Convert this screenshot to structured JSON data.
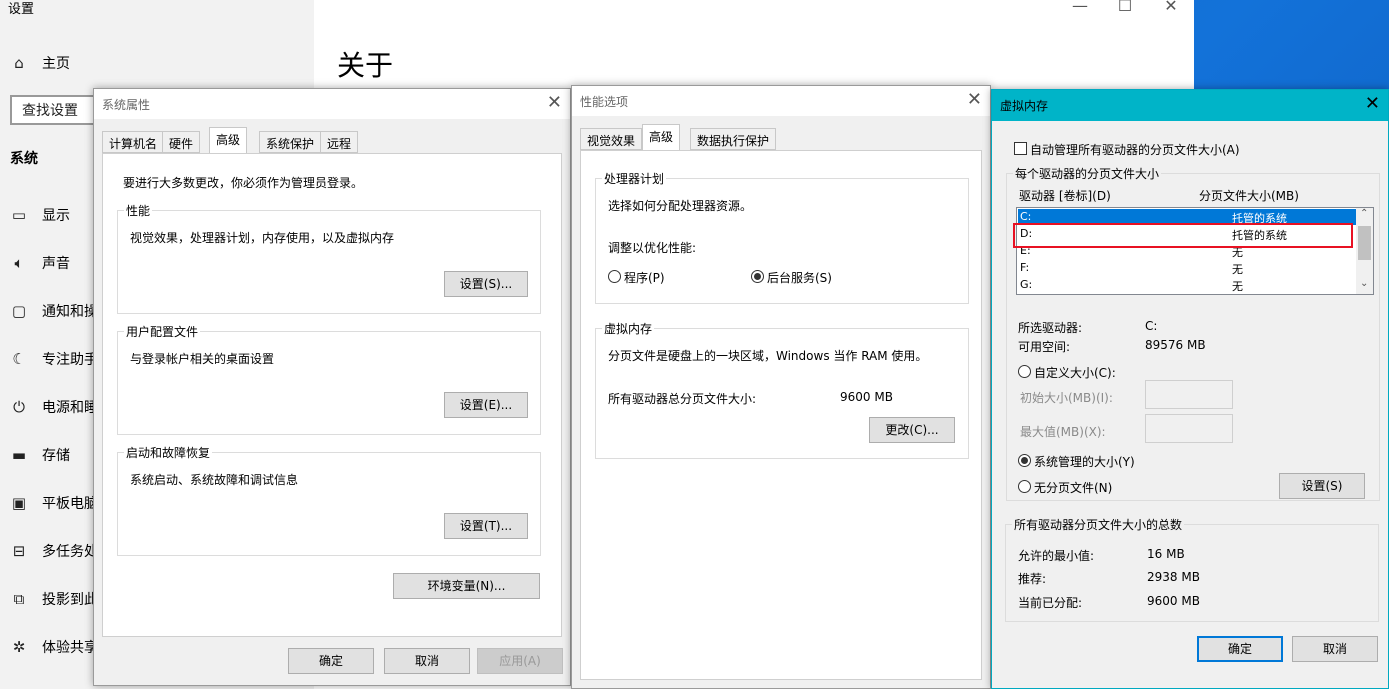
{
  "settings": {
    "title": "设置",
    "home": "主页",
    "search_placeholder": "查找设置",
    "section": "系统",
    "page_title": "关于",
    "nav": [
      {
        "label": "显示",
        "icon": "monitor-icon"
      },
      {
        "label": "声音",
        "icon": "speaker-icon"
      },
      {
        "label": "通知和操",
        "icon": "notification-icon"
      },
      {
        "label": "专注助手",
        "icon": "moon-icon"
      },
      {
        "label": "电源和睡",
        "icon": "power-icon"
      },
      {
        "label": "存储",
        "icon": "storage-icon"
      },
      {
        "label": "平板电脑",
        "icon": "tablet-icon"
      },
      {
        "label": "多任务处",
        "icon": "multitask-icon"
      },
      {
        "label": "投影到此",
        "icon": "project-icon"
      },
      {
        "label": "体验共享",
        "icon": "share-icon"
      }
    ],
    "controls": {
      "minimize": "—",
      "maximize": "☐",
      "close": "✕"
    }
  },
  "sysprop": {
    "title": "系统属性",
    "tabs": [
      "计算机名",
      "硬件",
      "高级",
      "系统保护",
      "远程"
    ],
    "active_tab": 2,
    "admin_note": "要进行大多数更改，你必须作为管理员登录。",
    "perf_label": "性能",
    "perf_desc": "视觉效果，处理器计划，内存使用，以及虚拟内存",
    "perf_btn": "设置(S)...",
    "profile_label": "用户配置文件",
    "profile_desc": "与登录帐户相关的桌面设置",
    "profile_btn": "设置(E)...",
    "startup_label": "启动和故障恢复",
    "startup_desc": "系统启动、系统故障和调试信息",
    "startup_btn": "设置(T)...",
    "env_btn": "环境变量(N)...",
    "ok": "确定",
    "cancel": "取消",
    "apply": "应用(A)"
  },
  "perfopt": {
    "title": "性能选项",
    "tabs": [
      "视觉效果",
      "高级",
      "数据执行保护"
    ],
    "active_tab": 1,
    "sched_label": "处理器计划",
    "sched_desc": "选择如何分配处理器资源。",
    "optimize_label": "调整以优化性能:",
    "opt_programs": "程序(P)",
    "opt_background": "后台服务(S)",
    "opt_selected": "background",
    "vm_label": "虚拟内存",
    "vm_desc": "分页文件是硬盘上的一块区域，Windows 当作 RAM 使用。",
    "vm_total_label": "所有驱动器总分页文件大小:",
    "vm_total_value": "9600 MB",
    "change_btn": "更改(C)..."
  },
  "vmem": {
    "title": "虚拟内存",
    "auto_manage": "自动管理所有驱动器的分页文件大小(A)",
    "auto_manage_checked": false,
    "per_drive_label": "每个驱动器的分页文件大小",
    "col_drive": "驱动器 [卷标](D)",
    "col_size": "分页文件大小(MB)",
    "drives": [
      {
        "name": "C:",
        "size": "托管的系统",
        "selected": true
      },
      {
        "name": "D:",
        "size": "托管的系统",
        "selected": false
      },
      {
        "name": "E:",
        "size": "无",
        "selected": false
      },
      {
        "name": "F:",
        "size": "无",
        "selected": false
      },
      {
        "name": "G:",
        "size": "无",
        "selected": false
      }
    ],
    "highlight_color": "#e81123",
    "selected_drive_label": "所选驱动器:",
    "selected_drive_value": "C:",
    "free_space_label": "可用空间:",
    "free_space_value": "89576 MB",
    "custom_size": "自定义大小(C):",
    "initial_size": "初始大小(MB)(I):",
    "max_size": "最大值(MB)(X):",
    "system_managed": "系统管理的大小(Y)",
    "no_paging": "无分页文件(N)",
    "size_mode": "system",
    "set_btn": "设置(S)",
    "total_label": "所有驱动器分页文件大小的总数",
    "min_allowed_label": "允许的最小值:",
    "min_allowed_value": "16 MB",
    "recommended_label": "推荐:",
    "recommended_value": "2938 MB",
    "current_label": "当前已分配:",
    "current_value": "9600 MB",
    "ok": "确定",
    "cancel": "取消"
  },
  "colors": {
    "accent": "#0078d7",
    "vm_title_bar": "#00b4c8"
  }
}
